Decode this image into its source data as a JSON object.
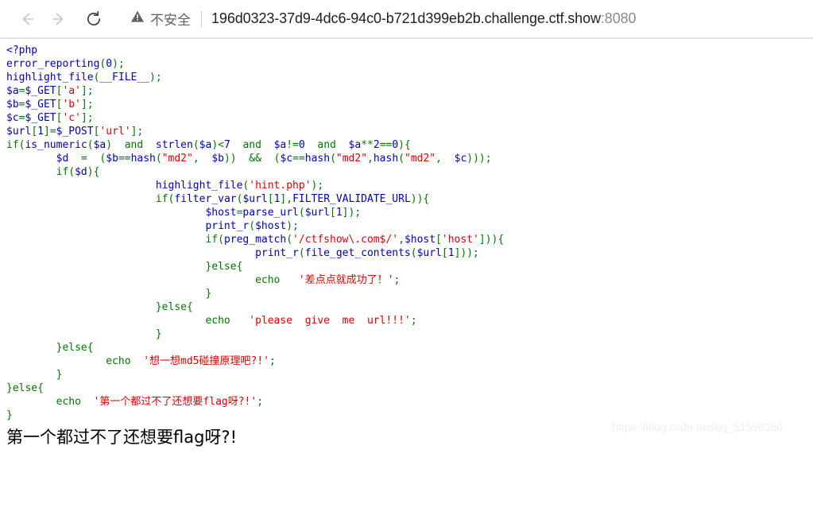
{
  "browser": {
    "back_icon": "arrow-left-icon",
    "forward_icon": "arrow-right-icon",
    "reload_icon": "reload-icon",
    "back_enabled": false,
    "forward_enabled": false,
    "security": {
      "icon": "warning-triangle-icon",
      "label": "不安全"
    },
    "url": {
      "host": "196d0323-37d9-4dc6-94c0-b721d399eb2b.challenge.ctf.show",
      "port": ":8080"
    }
  },
  "colors": {
    "php_default": "#0000BB",
    "php_keyword": "#007700",
    "php_string": "#DD0000",
    "security_text": "#5f6368",
    "url_text": "#202124",
    "url_port": "#8b8b8b"
  },
  "code": {
    "lines": [
      [
        {
          "t": "<?php",
          "c": "php"
        }
      ],
      [
        {
          "t": "error_reporting",
          "c": "default"
        },
        {
          "t": "(",
          "c": "keyword"
        },
        {
          "t": "0",
          "c": "default"
        },
        {
          "t": ");",
          "c": "keyword"
        }
      ],
      [
        {
          "t": "highlight_file",
          "c": "default"
        },
        {
          "t": "(",
          "c": "keyword"
        },
        {
          "t": "__FILE__",
          "c": "default"
        },
        {
          "t": ");",
          "c": "keyword"
        }
      ],
      [
        {
          "t": "$a",
          "c": "default"
        },
        {
          "t": "=",
          "c": "keyword"
        },
        {
          "t": "$_GET",
          "c": "default"
        },
        {
          "t": "[",
          "c": "keyword"
        },
        {
          "t": "'a'",
          "c": "string"
        },
        {
          "t": "];",
          "c": "keyword"
        }
      ],
      [
        {
          "t": "$b",
          "c": "default"
        },
        {
          "t": "=",
          "c": "keyword"
        },
        {
          "t": "$_GET",
          "c": "default"
        },
        {
          "t": "[",
          "c": "keyword"
        },
        {
          "t": "'b'",
          "c": "string"
        },
        {
          "t": "];",
          "c": "keyword"
        }
      ],
      [
        {
          "t": "$c",
          "c": "default"
        },
        {
          "t": "=",
          "c": "keyword"
        },
        {
          "t": "$_GET",
          "c": "default"
        },
        {
          "t": "[",
          "c": "keyword"
        },
        {
          "t": "'c'",
          "c": "string"
        },
        {
          "t": "];",
          "c": "keyword"
        }
      ],
      [
        {
          "t": "$url",
          "c": "default"
        },
        {
          "t": "[",
          "c": "keyword"
        },
        {
          "t": "1",
          "c": "default"
        },
        {
          "t": "]=",
          "c": "keyword"
        },
        {
          "t": "$_POST",
          "c": "default"
        },
        {
          "t": "[",
          "c": "keyword"
        },
        {
          "t": "'url'",
          "c": "string"
        },
        {
          "t": "];",
          "c": "keyword"
        }
      ],
      [
        {
          "t": "if",
          "c": "keyword"
        },
        {
          "t": "(",
          "c": "keyword"
        },
        {
          "t": "is_numeric",
          "c": "default"
        },
        {
          "t": "(",
          "c": "keyword"
        },
        {
          "t": "$a",
          "c": "default"
        },
        {
          "t": ")  ",
          "c": "keyword"
        },
        {
          "t": "and",
          "c": "keyword"
        },
        {
          "t": "  ",
          "c": "keyword"
        },
        {
          "t": "strlen",
          "c": "default"
        },
        {
          "t": "(",
          "c": "keyword"
        },
        {
          "t": "$a",
          "c": "default"
        },
        {
          "t": ")<",
          "c": "keyword"
        },
        {
          "t": "7",
          "c": "default"
        },
        {
          "t": "  ",
          "c": "keyword"
        },
        {
          "t": "and",
          "c": "keyword"
        },
        {
          "t": "  ",
          "c": "keyword"
        },
        {
          "t": "$a",
          "c": "default"
        },
        {
          "t": "!=",
          "c": "keyword"
        },
        {
          "t": "0",
          "c": "default"
        },
        {
          "t": "  ",
          "c": "keyword"
        },
        {
          "t": "and",
          "c": "keyword"
        },
        {
          "t": "  ",
          "c": "keyword"
        },
        {
          "t": "$a",
          "c": "default"
        },
        {
          "t": "**",
          "c": "keyword"
        },
        {
          "t": "2",
          "c": "default"
        },
        {
          "t": "==",
          "c": "keyword"
        },
        {
          "t": "0",
          "c": "default"
        },
        {
          "t": "){",
          "c": "keyword"
        }
      ],
      [
        {
          "t": "        ",
          "c": "keyword"
        },
        {
          "t": "$d",
          "c": "default"
        },
        {
          "t": "  =  (",
          "c": "keyword"
        },
        {
          "t": "$b",
          "c": "default"
        },
        {
          "t": "==",
          "c": "keyword"
        },
        {
          "t": "hash",
          "c": "default"
        },
        {
          "t": "(",
          "c": "keyword"
        },
        {
          "t": "\"md2\"",
          "c": "string"
        },
        {
          "t": ",  ",
          "c": "keyword"
        },
        {
          "t": "$b",
          "c": "default"
        },
        {
          "t": "))  ",
          "c": "keyword"
        },
        {
          "t": "&&",
          "c": "keyword"
        },
        {
          "t": "  (",
          "c": "keyword"
        },
        {
          "t": "$c",
          "c": "default"
        },
        {
          "t": "==",
          "c": "keyword"
        },
        {
          "t": "hash",
          "c": "default"
        },
        {
          "t": "(",
          "c": "keyword"
        },
        {
          "t": "\"md2\"",
          "c": "string"
        },
        {
          "t": ",",
          "c": "keyword"
        },
        {
          "t": "hash",
          "c": "default"
        },
        {
          "t": "(",
          "c": "keyword"
        },
        {
          "t": "\"md2\"",
          "c": "string"
        },
        {
          "t": ",  ",
          "c": "keyword"
        },
        {
          "t": "$c",
          "c": "default"
        },
        {
          "t": ")));",
          "c": "keyword"
        }
      ],
      [
        {
          "t": "        ",
          "c": "keyword"
        },
        {
          "t": "if",
          "c": "keyword"
        },
        {
          "t": "(",
          "c": "keyword"
        },
        {
          "t": "$d",
          "c": "default"
        },
        {
          "t": "){",
          "c": "keyword"
        }
      ],
      [
        {
          "t": "                        ",
          "c": "keyword"
        },
        {
          "t": "highlight_file",
          "c": "default"
        },
        {
          "t": "(",
          "c": "keyword"
        },
        {
          "t": "'hint.php'",
          "c": "string"
        },
        {
          "t": ");",
          "c": "keyword"
        }
      ],
      [
        {
          "t": "                        ",
          "c": "keyword"
        },
        {
          "t": "if",
          "c": "keyword"
        },
        {
          "t": "(",
          "c": "keyword"
        },
        {
          "t": "filter_var",
          "c": "default"
        },
        {
          "t": "(",
          "c": "keyword"
        },
        {
          "t": "$url",
          "c": "default"
        },
        {
          "t": "[",
          "c": "keyword"
        },
        {
          "t": "1",
          "c": "default"
        },
        {
          "t": "],",
          "c": "keyword"
        },
        {
          "t": "FILTER_VALIDATE_URL",
          "c": "default"
        },
        {
          "t": ")){",
          "c": "keyword"
        }
      ],
      [
        {
          "t": "                                ",
          "c": "keyword"
        },
        {
          "t": "$host",
          "c": "default"
        },
        {
          "t": "=",
          "c": "keyword"
        },
        {
          "t": "parse_url",
          "c": "default"
        },
        {
          "t": "(",
          "c": "keyword"
        },
        {
          "t": "$url",
          "c": "default"
        },
        {
          "t": "[",
          "c": "keyword"
        },
        {
          "t": "1",
          "c": "default"
        },
        {
          "t": "]);",
          "c": "keyword"
        }
      ],
      [
        {
          "t": "                                ",
          "c": "keyword"
        },
        {
          "t": "print_r",
          "c": "default"
        },
        {
          "t": "(",
          "c": "keyword"
        },
        {
          "t": "$host",
          "c": "default"
        },
        {
          "t": ");",
          "c": "keyword"
        }
      ],
      [
        {
          "t": "                                ",
          "c": "keyword"
        },
        {
          "t": "if",
          "c": "keyword"
        },
        {
          "t": "(",
          "c": "keyword"
        },
        {
          "t": "preg_match",
          "c": "default"
        },
        {
          "t": "(",
          "c": "keyword"
        },
        {
          "t": "'/ctfshow\\.com$/'",
          "c": "string"
        },
        {
          "t": ",",
          "c": "keyword"
        },
        {
          "t": "$host",
          "c": "default"
        },
        {
          "t": "[",
          "c": "keyword"
        },
        {
          "t": "'host'",
          "c": "string"
        },
        {
          "t": "])){",
          "c": "keyword"
        }
      ],
      [
        {
          "t": "                                        ",
          "c": "keyword"
        },
        {
          "t": "print_r",
          "c": "default"
        },
        {
          "t": "(",
          "c": "keyword"
        },
        {
          "t": "file_get_contents",
          "c": "default"
        },
        {
          "t": "(",
          "c": "keyword"
        },
        {
          "t": "$url",
          "c": "default"
        },
        {
          "t": "[",
          "c": "keyword"
        },
        {
          "t": "1",
          "c": "default"
        },
        {
          "t": "]));",
          "c": "keyword"
        }
      ],
      [
        {
          "t": "                                }",
          "c": "keyword"
        },
        {
          "t": "else",
          "c": "keyword"
        },
        {
          "t": "{",
          "c": "keyword"
        }
      ],
      [
        {
          "t": "                                        ",
          "c": "keyword"
        },
        {
          "t": "echo",
          "c": "keyword"
        },
        {
          "t": "   ",
          "c": "keyword"
        },
        {
          "t": "'差点点就成功了！'",
          "c": "string"
        },
        {
          "t": ";",
          "c": "keyword"
        }
      ],
      [
        {
          "t": "                                }",
          "c": "keyword"
        }
      ],
      [
        {
          "t": "                        }",
          "c": "keyword"
        },
        {
          "t": "else",
          "c": "keyword"
        },
        {
          "t": "{",
          "c": "keyword"
        }
      ],
      [
        {
          "t": "                                ",
          "c": "keyword"
        },
        {
          "t": "echo",
          "c": "keyword"
        },
        {
          "t": "   ",
          "c": "keyword"
        },
        {
          "t": "'please  give  me  url!!!'",
          "c": "string"
        },
        {
          "t": ";",
          "c": "keyword"
        }
      ],
      [
        {
          "t": "                        }",
          "c": "keyword"
        }
      ],
      [
        {
          "t": "        }",
          "c": "keyword"
        },
        {
          "t": "else",
          "c": "keyword"
        },
        {
          "t": "{",
          "c": "keyword"
        }
      ],
      [
        {
          "t": "                ",
          "c": "keyword"
        },
        {
          "t": "echo",
          "c": "keyword"
        },
        {
          "t": "  ",
          "c": "keyword"
        },
        {
          "t": "'想一想md5碰撞原理吧?!'",
          "c": "string"
        },
        {
          "t": ";",
          "c": "keyword"
        }
      ],
      [
        {
          "t": "        }",
          "c": "keyword"
        }
      ],
      [
        {
          "t": "}",
          "c": "keyword"
        },
        {
          "t": "else",
          "c": "keyword"
        },
        {
          "t": "{",
          "c": "keyword"
        }
      ],
      [
        {
          "t": "        ",
          "c": "keyword"
        },
        {
          "t": "echo",
          "c": "keyword"
        },
        {
          "t": "  ",
          "c": "keyword"
        },
        {
          "t": "'第一个都过不了还想要flag呀?!'",
          "c": "string"
        },
        {
          "t": ";",
          "c": "keyword"
        }
      ],
      [
        {
          "t": "}",
          "c": "keyword"
        }
      ]
    ]
  },
  "output": {
    "message": "第一个都过不了还想要flag呀?!"
  },
  "watermark": {
    "text": "https://blog.csdn.net/qq_51558360"
  }
}
